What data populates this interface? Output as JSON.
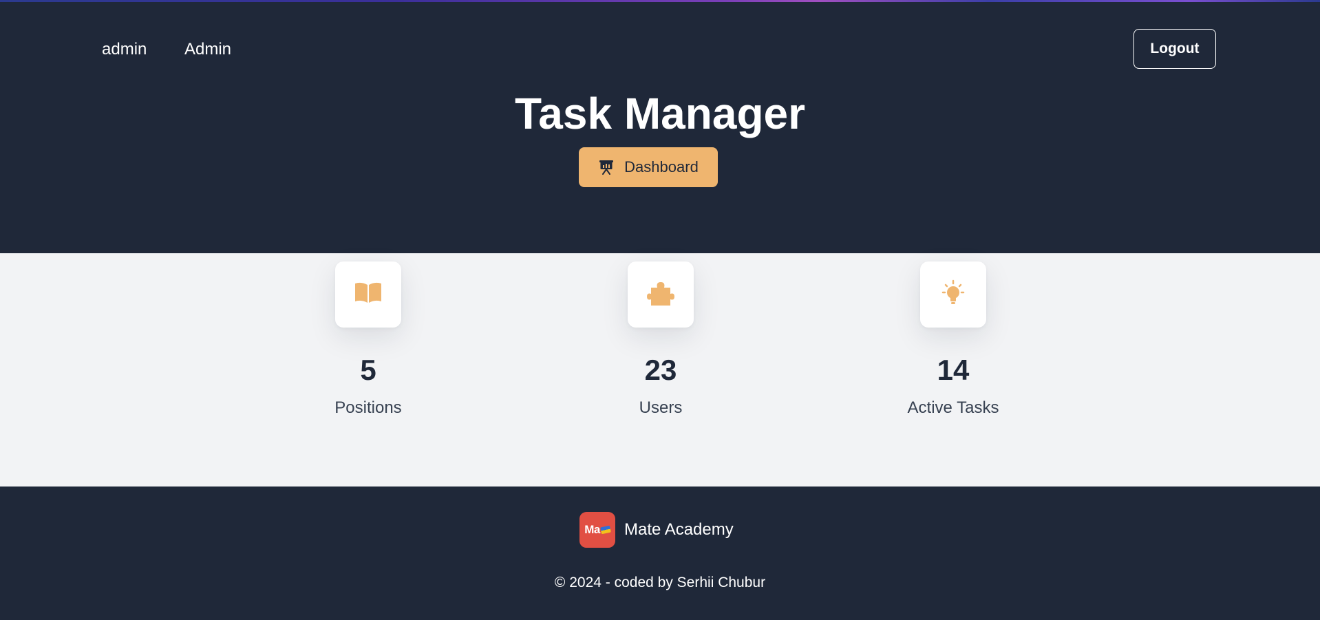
{
  "nav": {
    "username": "admin",
    "admin_link": "Admin",
    "logout_label": "Logout"
  },
  "hero": {
    "title": "Task Manager",
    "dashboard_label": "Dashboard"
  },
  "stats": [
    {
      "icon": "book-icon",
      "value": "5",
      "label": "Positions"
    },
    {
      "icon": "puzzle-icon",
      "value": "23",
      "label": "Users"
    },
    {
      "icon": "lightbulb-icon",
      "value": "14",
      "label": "Active Tasks"
    }
  ],
  "footer": {
    "brand_logo_text": "Ma",
    "brand_name": "Mate Academy",
    "copyright": "© 2024 - coded by Serhii Chubur"
  },
  "colors": {
    "dark_bg": "#1f2839",
    "accent": "#efb56f",
    "light_bg": "#f2f3f5",
    "brand_red": "#e14f43"
  }
}
